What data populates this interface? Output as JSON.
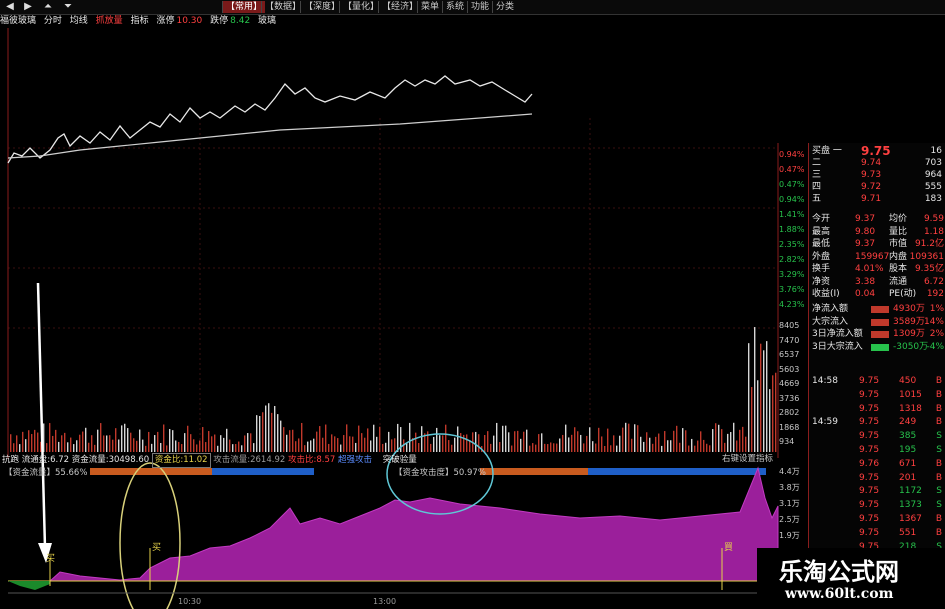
{
  "topbar": {
    "tabs": [
      {
        "label": "【常用】",
        "active": true
      },
      {
        "label": "【数据】",
        "active": false
      },
      {
        "label": "【深度】",
        "active": false
      },
      {
        "label": "【量化】",
        "active": false
      },
      {
        "label": "【经济】",
        "active": false
      },
      {
        "label": "菜单",
        "active": false
      },
      {
        "label": "系统",
        "active": false
      },
      {
        "label": "功能",
        "active": false
      },
      {
        "label": "分类",
        "active": false
      }
    ]
  },
  "infobar": {
    "stock": "福彼玻璃",
    "mode": "分时",
    "avg": "均线",
    "buy_vol": "抓放量",
    "indicator": "指标",
    "limit_up_label": "涨停",
    "limit_up": "10.30",
    "limit_down_label": "跌停",
    "limit_down": "8.42",
    "name2": "玻璃"
  },
  "right_axis_pct": [
    "0.94%",
    "0.47%",
    "0.47%",
    "0.94%",
    "1.41%",
    "1.88%",
    "2.35%",
    "2.82%",
    "3.29%",
    "3.76%",
    "4.23%"
  ],
  "volume_axis": [
    "8405",
    "7470",
    "6537",
    "5603",
    "4669",
    "3736",
    "2802",
    "1868",
    "934"
  ],
  "indicator_axis": [
    "4.4万",
    "3.8万",
    "3.1万",
    "2.5万",
    "1.9万"
  ],
  "bid_ask": [
    {
      "label": "买盘 一",
      "price": "9.75",
      "vol": "16"
    },
    {
      "label": "二",
      "price": "9.74",
      "vol": "703"
    },
    {
      "label": "三",
      "price": "9.73",
      "vol": "964"
    },
    {
      "label": "四",
      "price": "9.72",
      "vol": "555"
    },
    {
      "label": "五",
      "price": "9.71",
      "vol": "183"
    }
  ],
  "quote": [
    {
      "k1": "今开",
      "v1": "9.37",
      "k2": "均价",
      "v2": "9.59"
    },
    {
      "k1": "最高",
      "v1": "9.80",
      "k2": "量比",
      "v2": "1.18"
    },
    {
      "k1": "最低",
      "v1": "9.37",
      "k2": "市值",
      "v2": "91.2亿"
    },
    {
      "k1": "外盘",
      "v1": "159967",
      "k2": "内盘",
      "v2": "109361"
    },
    {
      "k1": "换手",
      "v1": "4.01%",
      "k2": "股本",
      "v2": "9.35亿"
    },
    {
      "k1": "净资",
      "v1": "3.38",
      "k2": "流通",
      "v2": "6.72"
    },
    {
      "k1": "收益(Ⅰ)",
      "v1": "0.04",
      "k2": "PE(动)",
      "v2": "192"
    }
  ],
  "flows": [
    {
      "label": "净流入额",
      "value": "4930万",
      "extra": "1%"
    },
    {
      "label": "大宗流入",
      "value": "3589万",
      "extra": "14%"
    },
    {
      "label": "3日净流入额",
      "value": "1309万",
      "extra": "2%"
    },
    {
      "label": "3日大宗流入",
      "value": "-3050万",
      "extra": "-4%"
    }
  ],
  "ticks": [
    {
      "time": "14:58",
      "price": "9.75",
      "vol": "450",
      "side": "B"
    },
    {
      "time": "",
      "price": "9.75",
      "vol": "1015",
      "side": "B"
    },
    {
      "time": "",
      "price": "9.75",
      "vol": "1318",
      "side": "B"
    },
    {
      "time": "14:59",
      "price": "9.75",
      "vol": "249",
      "side": "B"
    },
    {
      "time": "",
      "price": "9.75",
      "vol": "385",
      "side": "S"
    },
    {
      "time": "",
      "price": "9.75",
      "vol": "195",
      "side": "S"
    },
    {
      "time": "",
      "price": "9.76",
      "vol": "671",
      "side": "B"
    },
    {
      "time": "",
      "price": "9.75",
      "vol": "201",
      "side": "B"
    },
    {
      "time": "",
      "price": "9.75",
      "vol": "1172",
      "side": "S"
    },
    {
      "time": "",
      "price": "9.75",
      "vol": "1373",
      "side": "S"
    },
    {
      "time": "",
      "price": "9.75",
      "vol": "1367",
      "side": "B"
    },
    {
      "time": "",
      "price": "9.75",
      "vol": "551",
      "side": "B"
    },
    {
      "time": "",
      "price": "9.75",
      "vol": "218",
      "side": "S"
    }
  ],
  "indicator_bar": {
    "a": "抗跑",
    "b": "流通盘:6.72",
    "c": "资金流量:30498.60",
    "d": "资金比:11.02",
    "e": "攻击流量:2614.92",
    "f": "攻击比:8.57",
    "g": "超强攻击",
    "h": "突破验量",
    "right": "右键设置指标"
  },
  "indicator_labels": {
    "left": "【资金流量】55.66%",
    "mid": "【资金攻击度】50.97%"
  },
  "markers": {
    "m1": "买",
    "m2": "买",
    "m3": "買"
  },
  "time_labels": {
    "t1": "10:30",
    "t2": "13:00"
  },
  "watermark": {
    "title": "乐淘公式网",
    "url": "www.60lt.com"
  },
  "colors": {
    "price_line": "#e8e8e8",
    "avg_line": "#d8d8d8",
    "volume": "#c0392b",
    "indicator_fill": "#9b1f9b",
    "bar_orange": "#c85b1f",
    "bar_blue": "#1f5fc8"
  }
}
